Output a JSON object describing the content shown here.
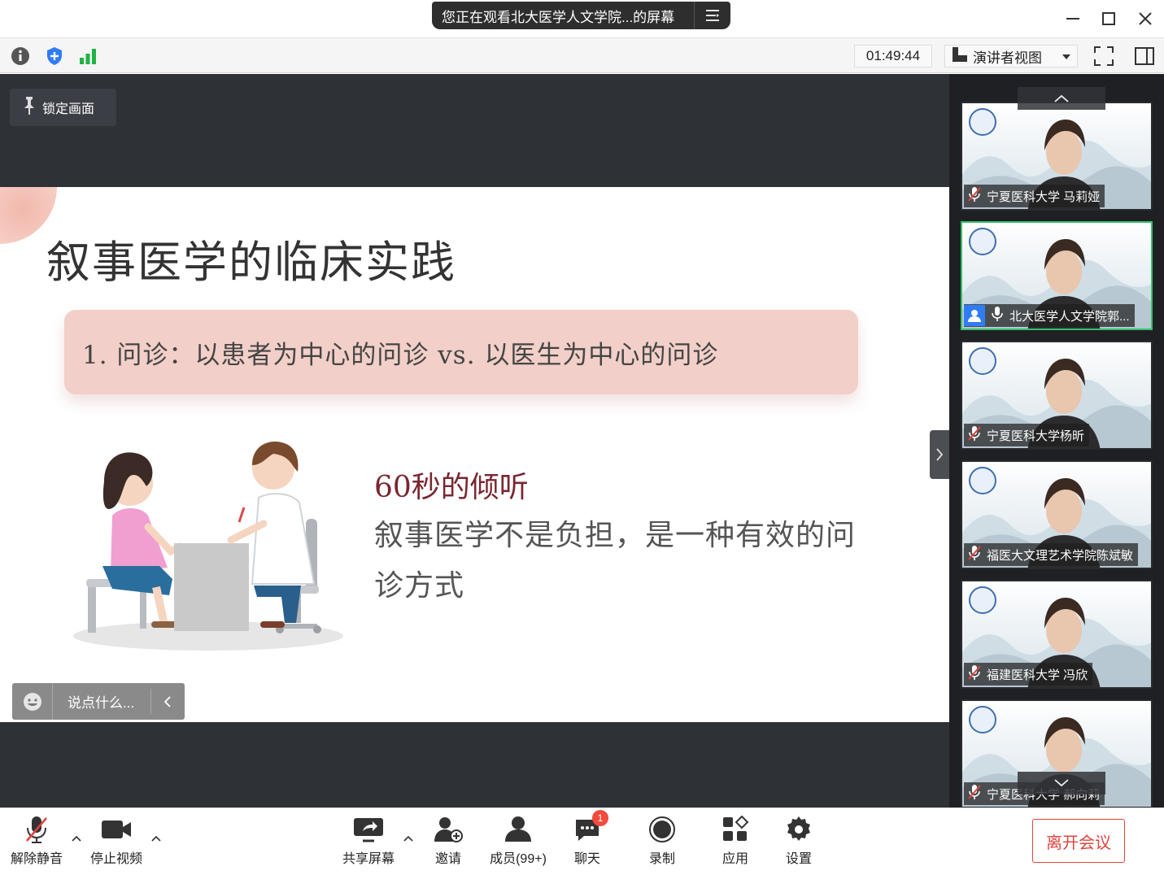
{
  "titlebar": {
    "share_notice": "您正在观看北大医学人文学院...的屏幕"
  },
  "toolbar": {
    "timer": "01:49:44",
    "view_mode": "演讲者视图"
  },
  "stage": {
    "lock_label": "锁定画面",
    "comment_placeholder": "说点什么..."
  },
  "slide": {
    "title": "叙事医学的临床实践",
    "point": "1.  问诊：以患者为中心的问诊 vs. 以医生为中心的问诊",
    "heading": "60秒的倾听",
    "body": "叙事医学不是负担，是一种有效的问诊方式"
  },
  "participants": [
    {
      "name": "宁夏医科大学 马莉娅",
      "muted": true,
      "active": false
    },
    {
      "name": "北大医学人文学院郭...",
      "muted": false,
      "active": true
    },
    {
      "name": "宁夏医科大学杨昕",
      "muted": true,
      "active": false
    },
    {
      "name": "福医大文理艺术学院陈斌敏",
      "muted": true,
      "active": false
    },
    {
      "name": "福建医科大学 冯欣",
      "muted": true,
      "active": false
    },
    {
      "name": "宁夏医科大学 郝向莉",
      "muted": true,
      "active": false
    }
  ],
  "bottombar": {
    "unmute": "解除静音",
    "stop_video": "停止视频",
    "share_screen": "共享屏幕",
    "invite": "邀请",
    "members": "成员(99+)",
    "chat": "聊天",
    "chat_badge": "1",
    "record": "录制",
    "apps": "应用",
    "settings": "设置",
    "leave": "离开会议"
  },
  "colors": {
    "leave_red": "#e0443e",
    "active_green": "#36c16a",
    "slide_pink": "#f2cfc8",
    "heading_maroon": "#7a2630"
  }
}
